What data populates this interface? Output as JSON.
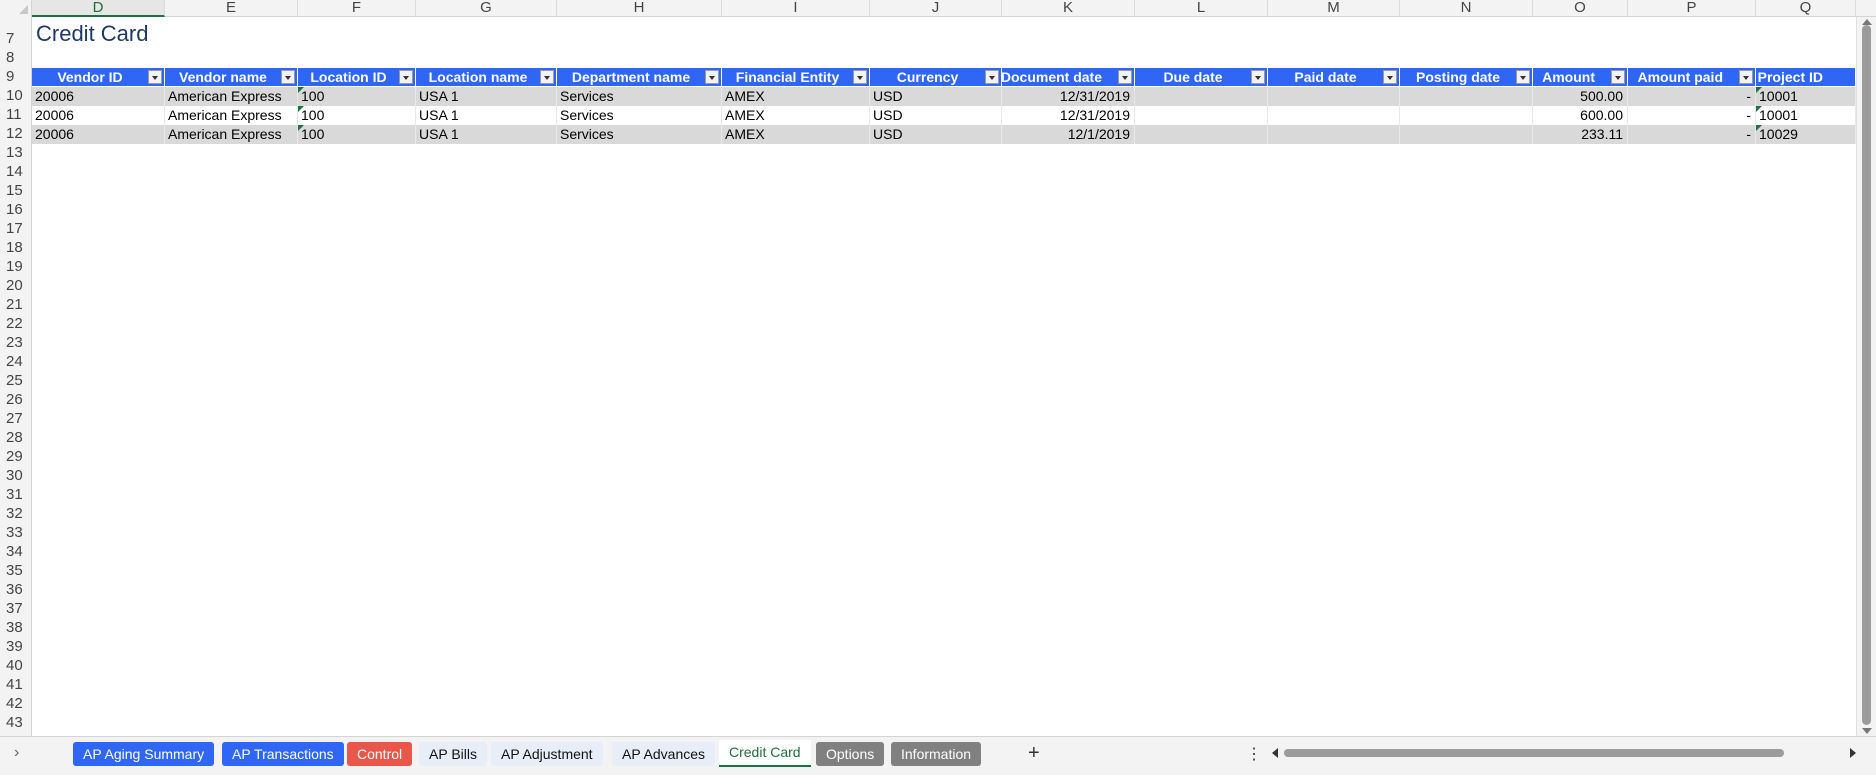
{
  "columns": [
    "D",
    "E",
    "F",
    "G",
    "H",
    "I",
    "J",
    "K",
    "L",
    "M",
    "N",
    "O",
    "P",
    "Q"
  ],
  "selected_column": "D",
  "rows": [
    "7",
    "8",
    "9",
    "10",
    "11",
    "12",
    "13",
    "14",
    "15",
    "16",
    "17",
    "18",
    "19",
    "20",
    "21",
    "22",
    "23",
    "24",
    "25",
    "26",
    "27",
    "28",
    "29",
    "30",
    "31",
    "32",
    "33",
    "34",
    "35",
    "36",
    "37",
    "38",
    "39",
    "40",
    "41",
    "42",
    "43"
  ],
  "sheet_title": "Credit Card",
  "table": {
    "headers": [
      "Vendor ID",
      "Vendor name",
      "Location ID",
      "Location name",
      "Department name",
      "Financial Entity",
      "Currency",
      "Document date",
      "Due date",
      "Paid date",
      "Posting date",
      "Amount",
      "Amount paid",
      "Project ID"
    ],
    "rows": [
      [
        "20006",
        "American Express",
        "100",
        "USA 1",
        "Services",
        "AMEX",
        "USD",
        "12/31/2019",
        "",
        "",
        "",
        "500.00",
        "-",
        "10001"
      ],
      [
        "20006",
        "American Express",
        "100",
        "USA 1",
        "Services",
        "AMEX",
        "USD",
        "12/31/2019",
        "",
        "",
        "",
        "600.00",
        "-",
        "10001"
      ],
      [
        "20006",
        "American Express",
        "100",
        "USA 1",
        "Services",
        "AMEX",
        "USD",
        "12/1/2019",
        "",
        "",
        "",
        "233.11",
        "-",
        "10029"
      ]
    ]
  },
  "tabs": [
    {
      "label": "AP Aging Summary",
      "style": "blue"
    },
    {
      "label": "AP Transactions",
      "style": "blue"
    },
    {
      "label": "Control",
      "style": "red"
    },
    {
      "label": "AP Bills",
      "style": "light"
    },
    {
      "label": "AP Adjustment",
      "style": "light"
    },
    {
      "label": "AP Advances",
      "style": "light"
    },
    {
      "label": "Credit Card",
      "style": "active"
    },
    {
      "label": "Options",
      "style": "gray"
    },
    {
      "label": "Information",
      "style": "gray"
    }
  ],
  "tab_nav_icon": "chevron-right-icon",
  "add_sheet_icon": "plus-icon",
  "more_icon": "vertical-ellipsis-icon",
  "accent_color": "#2f66f5"
}
